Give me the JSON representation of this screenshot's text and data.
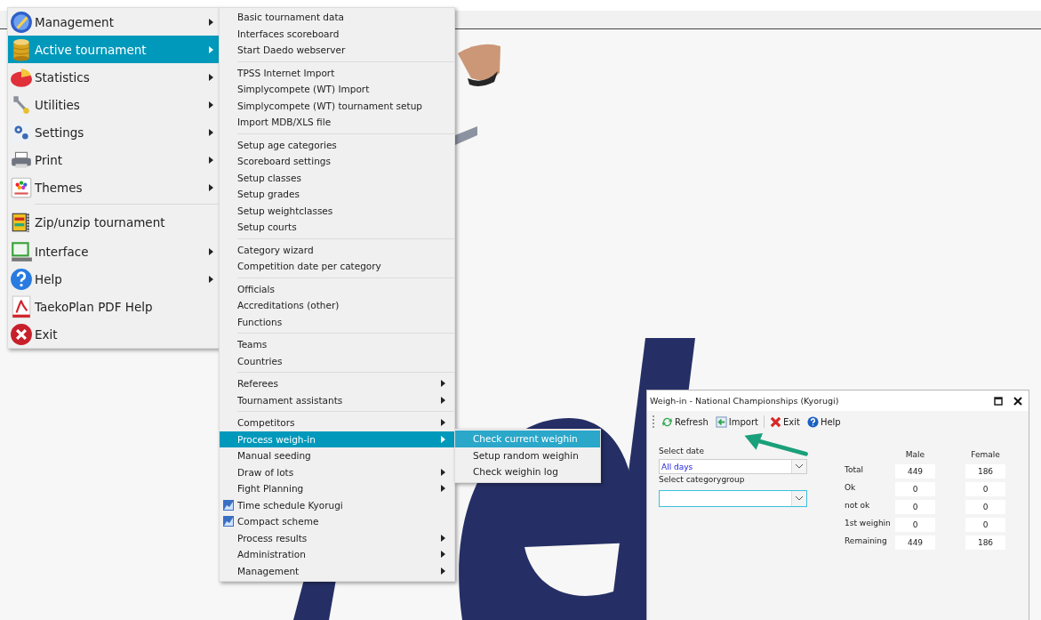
{
  "main_menu": {
    "groups": [
      [
        {
          "label": "Management",
          "selected": false,
          "has_submenu": true
        },
        {
          "label": "Active tournament",
          "selected": true,
          "has_submenu": true
        },
        {
          "label": "Statistics",
          "selected": false,
          "has_submenu": true
        },
        {
          "label": "Utilities",
          "selected": false,
          "has_submenu": true
        },
        {
          "label": "Settings",
          "selected": false,
          "has_submenu": true
        },
        {
          "label": "Print",
          "selected": false,
          "has_submenu": true
        },
        {
          "label": "Themes",
          "selected": false,
          "has_submenu": true
        }
      ],
      [
        {
          "label": "Zip/unzip tournament",
          "selected": false,
          "has_submenu": false
        },
        {
          "label": "Interface",
          "selected": false,
          "has_submenu": true
        },
        {
          "label": "Help",
          "selected": false,
          "has_submenu": true
        },
        {
          "label": "TaekoPlan PDF Help",
          "selected": false,
          "has_submenu": false
        },
        {
          "label": "Exit",
          "selected": false,
          "has_submenu": false
        }
      ]
    ]
  },
  "submenu": {
    "groups": [
      [
        {
          "label": "Basic tournament data",
          "selected": false,
          "has_submenu": false,
          "has_icon": false
        },
        {
          "label": "Interfaces scoreboard",
          "selected": false,
          "has_submenu": false,
          "has_icon": false
        },
        {
          "label": "Start Daedo webserver",
          "selected": false,
          "has_submenu": false,
          "has_icon": false
        }
      ],
      [
        {
          "label": "TPSS Internet Import",
          "selected": false,
          "has_submenu": false,
          "has_icon": false
        },
        {
          "label": "Simplycompete (WT) Import",
          "selected": false,
          "has_submenu": false,
          "has_icon": false
        },
        {
          "label": "Simplycompete (WT) tournament setup",
          "selected": false,
          "has_submenu": false,
          "has_icon": false
        },
        {
          "label": "Import MDB/XLS file",
          "selected": false,
          "has_submenu": false,
          "has_icon": false
        }
      ],
      [
        {
          "label": "Setup age categories",
          "selected": false,
          "has_submenu": false,
          "has_icon": false
        },
        {
          "label": "Scoreboard settings",
          "selected": false,
          "has_submenu": false,
          "has_icon": false
        },
        {
          "label": "Setup classes",
          "selected": false,
          "has_submenu": false,
          "has_icon": false
        },
        {
          "label": "Setup grades",
          "selected": false,
          "has_submenu": false,
          "has_icon": false
        },
        {
          "label": "Setup weightclasses",
          "selected": false,
          "has_submenu": false,
          "has_icon": false
        },
        {
          "label": "Setup courts",
          "selected": false,
          "has_submenu": false,
          "has_icon": false
        }
      ],
      [
        {
          "label": "Category wizard",
          "selected": false,
          "has_submenu": false,
          "has_icon": false
        },
        {
          "label": "Competition date per category",
          "selected": false,
          "has_submenu": false,
          "has_icon": false
        }
      ],
      [
        {
          "label": "Officials",
          "selected": false,
          "has_submenu": false,
          "has_icon": false
        },
        {
          "label": "Accreditations (other)",
          "selected": false,
          "has_submenu": false,
          "has_icon": false
        },
        {
          "label": "Functions",
          "selected": false,
          "has_submenu": false,
          "has_icon": false
        }
      ],
      [
        {
          "label": "Teams",
          "selected": false,
          "has_submenu": false,
          "has_icon": false
        },
        {
          "label": "Countries",
          "selected": false,
          "has_submenu": false,
          "has_icon": false
        }
      ],
      [
        {
          "label": "Referees",
          "selected": false,
          "has_submenu": true,
          "has_icon": false
        },
        {
          "label": "Tournament assistants",
          "selected": false,
          "has_submenu": true,
          "has_icon": false
        }
      ],
      [
        {
          "label": "Competitors",
          "selected": false,
          "has_submenu": true,
          "has_icon": false
        },
        {
          "label": "Process weigh-in",
          "selected": true,
          "has_submenu": true,
          "has_icon": false
        },
        {
          "label": "Manual seeding",
          "selected": false,
          "has_submenu": false,
          "has_icon": false
        },
        {
          "label": "Draw of lots",
          "selected": false,
          "has_submenu": true,
          "has_icon": false
        },
        {
          "label": "Fight Planning",
          "selected": false,
          "has_submenu": true,
          "has_icon": false
        },
        {
          "label": "Time schedule Kyorugi",
          "selected": false,
          "has_submenu": false,
          "has_icon": true
        },
        {
          "label": "Compact scheme",
          "selected": false,
          "has_submenu": false,
          "has_icon": true
        },
        {
          "label": "Process results",
          "selected": false,
          "has_submenu": true,
          "has_icon": false
        },
        {
          "label": "Administration",
          "selected": false,
          "has_submenu": true,
          "has_icon": false
        },
        {
          "label": "Management",
          "selected": false,
          "has_submenu": true,
          "has_icon": false
        }
      ]
    ]
  },
  "weighin_submenu": [
    {
      "label": "Check current weighin",
      "selected": true
    },
    {
      "label": "Setup random weighin",
      "selected": false
    },
    {
      "label": "Check weighin log",
      "selected": false
    }
  ],
  "weighin_window": {
    "title": "Weigh-in - National Championships (Kyorugi)",
    "toolbar": [
      {
        "label": "Refresh"
      },
      {
        "label": "Import"
      },
      {
        "label": "Exit"
      },
      {
        "label": "Help"
      }
    ],
    "date_label": "Select date",
    "date_value": "All days",
    "category_label": "Select categorygroup",
    "columns": [
      "Male",
      "Female"
    ],
    "rows": [
      {
        "label": "Total",
        "male": "449",
        "female": "186"
      },
      {
        "label": "Ok",
        "male": "0",
        "female": "0"
      },
      {
        "label": "not ok",
        "male": "0",
        "female": "0"
      },
      {
        "label": "1st weighin",
        "male": "0",
        "female": "0"
      },
      {
        "label": "Remaining",
        "male": "449",
        "female": "186"
      }
    ]
  }
}
